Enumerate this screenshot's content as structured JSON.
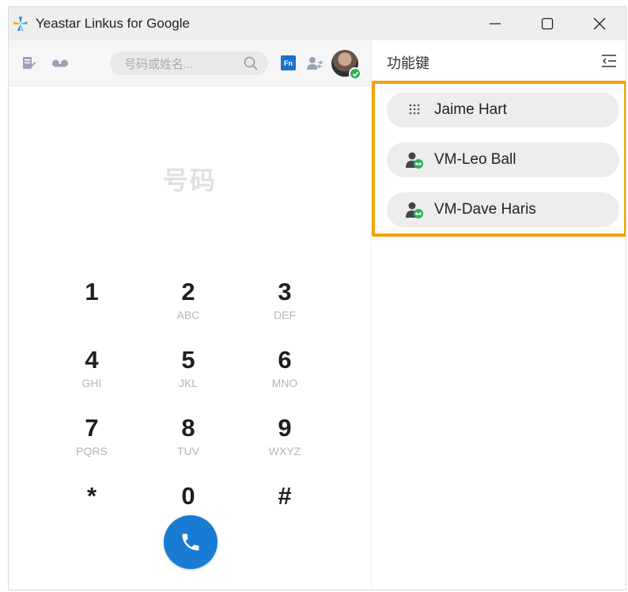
{
  "window": {
    "title": "Yeastar Linkus for Google"
  },
  "toolbar": {
    "search_placeholder": "号码或姓名...",
    "fn_badge": "Fn",
    "icons": [
      "notes-icon",
      "voicemail-icon",
      "search-icon",
      "fn-icon",
      "contact-transfer-icon",
      "avatar"
    ]
  },
  "dialer": {
    "number_placeholder": "号码",
    "keys": [
      {
        "digit": "1",
        "letters": ""
      },
      {
        "digit": "2",
        "letters": "ABC"
      },
      {
        "digit": "3",
        "letters": "DEF"
      },
      {
        "digit": "4",
        "letters": "GHI"
      },
      {
        "digit": "5",
        "letters": "JKL"
      },
      {
        "digit": "6",
        "letters": "MNO"
      },
      {
        "digit": "7",
        "letters": "PQRS"
      },
      {
        "digit": "8",
        "letters": "TUV"
      },
      {
        "digit": "9",
        "letters": "WXYZ"
      },
      {
        "digit": "*",
        "letters": ""
      },
      {
        "digit": "0",
        "letters": "+"
      },
      {
        "digit": "#",
        "letters": ""
      }
    ]
  },
  "function_keys": {
    "title": "功能键",
    "items": [
      {
        "label": "Jaime Hart",
        "icon": "dialpad-icon"
      },
      {
        "label": "VM-Leo Ball",
        "icon": "voicemail-contact-icon"
      },
      {
        "label": "VM-Dave Haris",
        "icon": "voicemail-contact-icon"
      }
    ]
  },
  "colors": {
    "accent": "#1a7bd4",
    "highlight": "#f2a20c",
    "status_green": "#2db05a"
  }
}
